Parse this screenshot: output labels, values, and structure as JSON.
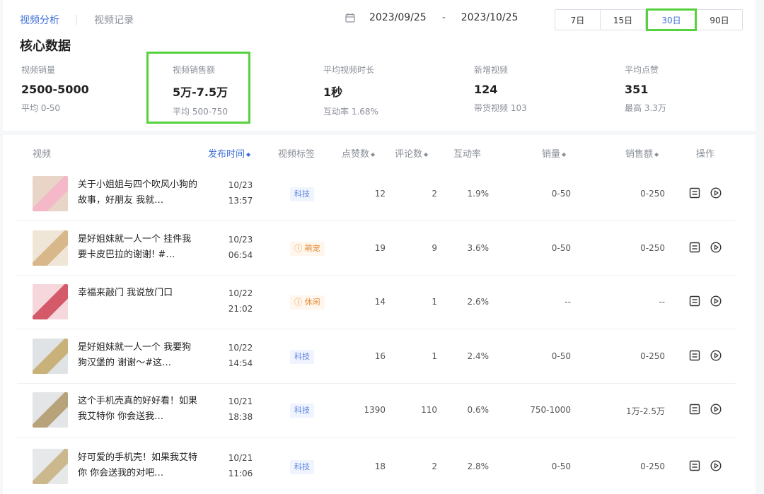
{
  "tabs": [
    {
      "label": "视频分析",
      "active": true
    },
    {
      "label": "视频记录",
      "active": false
    }
  ],
  "date_range": {
    "start": "2023/09/25",
    "separator": "-",
    "end": "2023/10/25"
  },
  "periods": [
    {
      "label": "7日",
      "active": false
    },
    {
      "label": "15日",
      "active": false
    },
    {
      "label": "30日",
      "active": true
    },
    {
      "label": "90日",
      "active": false
    }
  ],
  "section_title": "核心数据",
  "metrics": [
    {
      "label": "视频销量",
      "value": "2500-5000",
      "sub": "平均 0-50"
    },
    {
      "label": "视频销售额",
      "value": "5万-7.5万",
      "sub": "平均 500-750"
    },
    {
      "label": "平均视频时长",
      "value": "1秒",
      "sub": "互动率 1.68%"
    },
    {
      "label": "新增视频",
      "value": "124",
      "sub": "带货视频 103"
    },
    {
      "label": "平均点赞",
      "value": "351",
      "sub": "最高 3.3万"
    }
  ],
  "table": {
    "headers": {
      "video": "视频",
      "publish_time": "发布时间",
      "tag": "视频标签",
      "likes": "点赞数",
      "comments": "评论数",
      "engagement": "互动率",
      "sales": "销量",
      "revenue": "销售额",
      "actions": "操作"
    },
    "rows": [
      {
        "title": "关于小姐姐与四个吹风小狗的故事，好朋友 我就…",
        "date": "10/23",
        "time": "13:57",
        "tag": "科技",
        "tag_type": "tech",
        "likes": "12",
        "comments": "2",
        "engagement": "1.9%",
        "sales": "0-50",
        "revenue": "0-250"
      },
      {
        "title": "是好姐妹就一人一个 挂件我要卡皮巴拉的谢谢! #…",
        "date": "10/23",
        "time": "06:54",
        "tag": "ⓘ 萌宠",
        "tag_type": "warn",
        "likes": "19",
        "comments": "9",
        "engagement": "3.6%",
        "sales": "0-50",
        "revenue": "0-250"
      },
      {
        "title": "幸福来敲门 我说放门口",
        "date": "10/22",
        "time": "21:02",
        "tag": "ⓘ 休闲",
        "tag_type": "warn",
        "likes": "14",
        "comments": "1",
        "engagement": "2.6%",
        "sales": "--",
        "revenue": "--"
      },
      {
        "title": "是好姐妹就一人一个 我要狗狗汉堡的 谢谢～#这…",
        "date": "10/22",
        "time": "14:54",
        "tag": "科技",
        "tag_type": "tech",
        "likes": "16",
        "comments": "1",
        "engagement": "2.4%",
        "sales": "0-50",
        "revenue": "0-250"
      },
      {
        "title": "这个手机壳真的好好看！如果我艾特你 你会送我…",
        "date": "10/21",
        "time": "18:38",
        "tag": "科技",
        "tag_type": "tech",
        "likes": "1390",
        "comments": "110",
        "engagement": "0.6%",
        "sales": "750-1000",
        "revenue": "1万-2.5万"
      },
      {
        "title": "好可爱的手机壳！如果我艾特你 你会送我的对吧…",
        "date": "10/21",
        "time": "11:06",
        "tag": "科技",
        "tag_type": "tech",
        "likes": "18",
        "comments": "2",
        "engagement": "2.8%",
        "sales": "0-50",
        "revenue": "0-250"
      }
    ]
  },
  "colors": {
    "accent": "#3d6fd8",
    "highlight": "#55d23c",
    "tech_tag_text": "#5d84e0",
    "warn_tag_text": "#e48b35"
  },
  "icons": {
    "calendar": "calendar-icon",
    "detail": "document-icon",
    "play": "play-circle-icon",
    "sort": "sort-icon"
  }
}
